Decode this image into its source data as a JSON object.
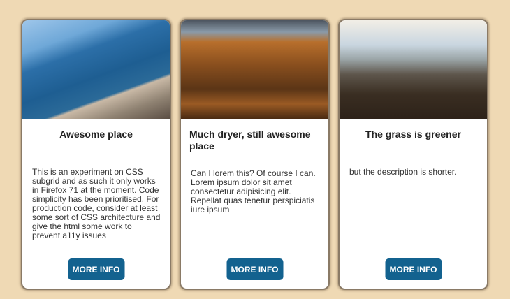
{
  "cards": [
    {
      "title": "Awesome place",
      "description": "This is an experiment on CSS subgrid and as such it only works in Firefox 71 at the moment. Code simplicity has been prioritised. For production code, consider at least some sort of CSS architecture and give the html some work to prevent a11y issues",
      "button": "MORE INFO"
    },
    {
      "title": "Much dryer, still awesome place",
      "description": "Can I lorem this? Of course I can. Lorem ipsum dolor sit amet consectetur adipisicing elit. Repellat quas tenetur perspiciatis iure ipsum",
      "button": "MORE INFO"
    },
    {
      "title": "The grass is greener",
      "description": "but the description is shorter.",
      "button": "MORE INFO"
    }
  ]
}
